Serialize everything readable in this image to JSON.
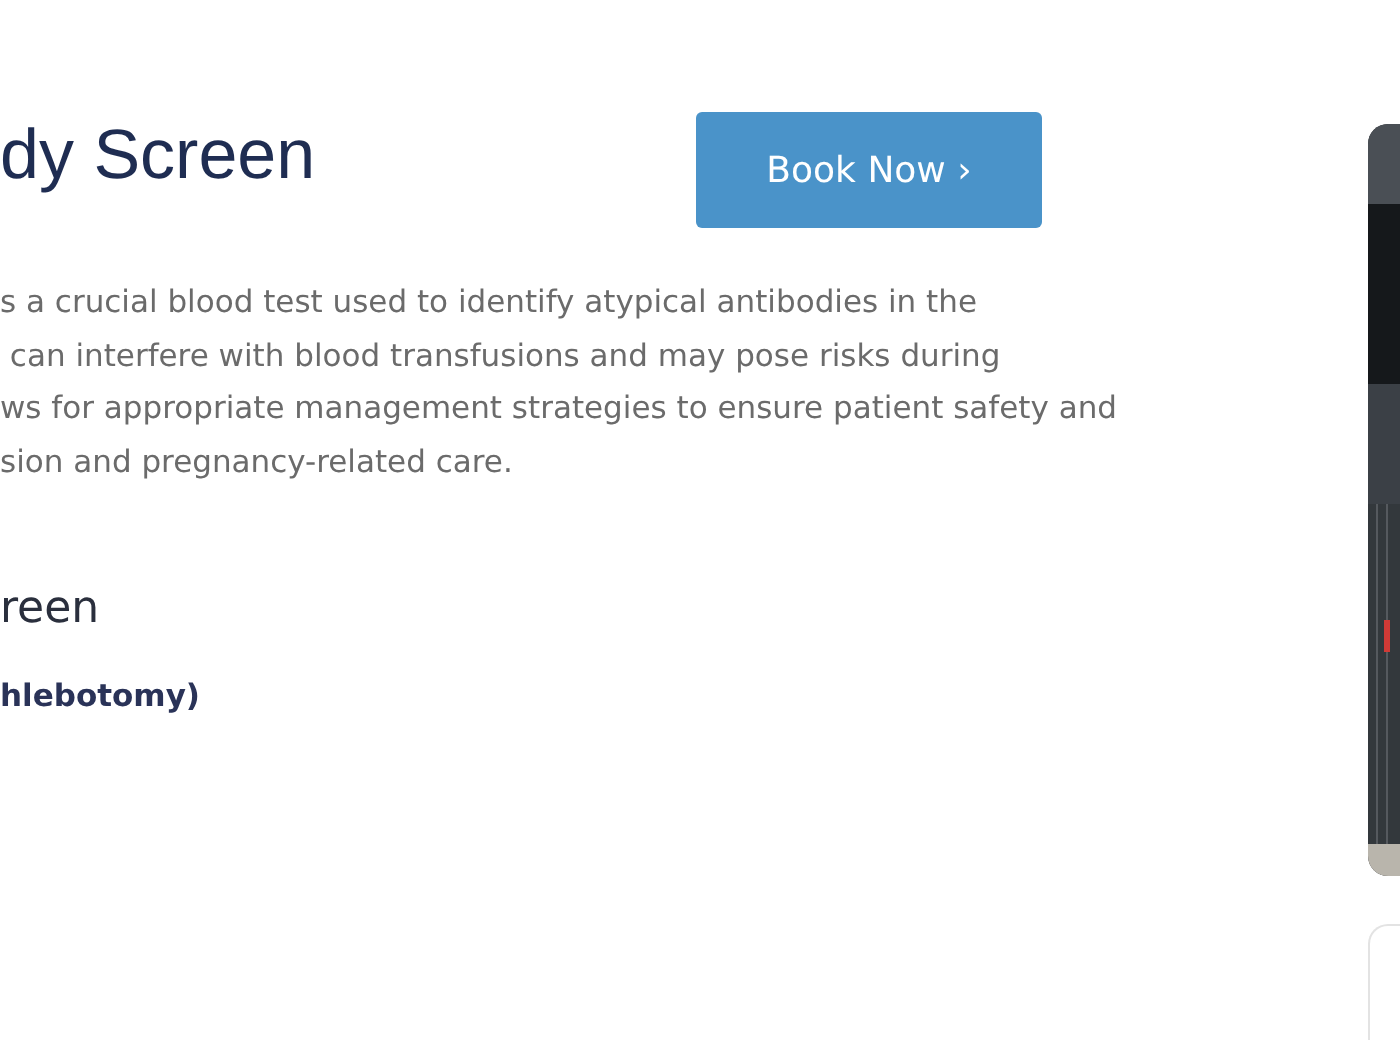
{
  "heading": "dy Screen",
  "book_button": {
    "label": "Book Now ›"
  },
  "description": [
    "s a crucial blood test used to identify atypical antibodies in the",
    " can interfere with blood transfusions and may pose risks during",
    "ws for appropriate management strategies to ensure patient safety and",
    "sion and pregnancy-related care."
  ],
  "subheading": "reen",
  "detail": "hlebotomy)"
}
